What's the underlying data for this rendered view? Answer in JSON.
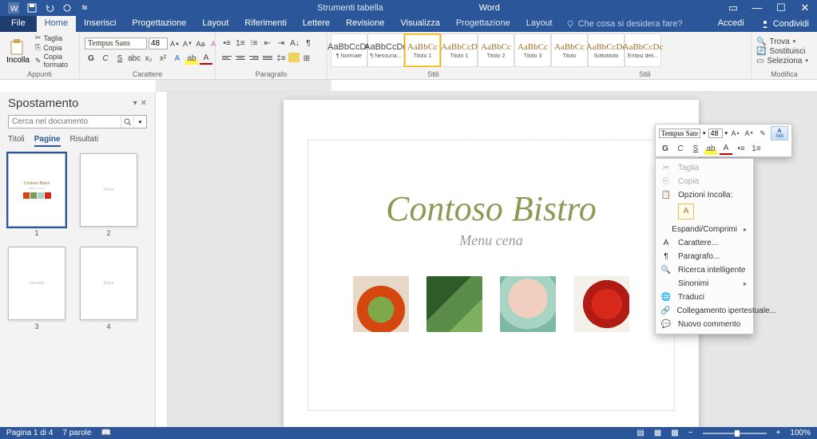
{
  "titlebar": {
    "contextual_tab_title": "Strumenti tabella",
    "app_name": "Word"
  },
  "tabs": {
    "file": "File",
    "home": "Home",
    "insert": "Inserisci",
    "design": "Progettazione",
    "layout": "Layout",
    "references": "Riferimenti",
    "mailings": "Lettere",
    "review": "Revisione",
    "view": "Visualizza",
    "table_design": "Progettazione",
    "table_layout": "Layout",
    "tell_me": "Che cosa si desidera fare?",
    "sign_in": "Accedi",
    "share": "Condividi"
  },
  "ribbon": {
    "clipboard": {
      "paste": "Incolla",
      "cut": "Taglia",
      "copy": "Copia",
      "format_painter": "Copia formato",
      "label": "Appunti"
    },
    "font": {
      "name": "Tempus Sans",
      "size": "48",
      "bold": "G",
      "italic": "C",
      "underline": "S",
      "label": "Carattere"
    },
    "paragraph": {
      "label": "Paragrafo"
    },
    "styles": {
      "label": "Stili",
      "items": [
        {
          "preview": "AaBbCcDc",
          "name": "¶ Normale",
          "normal": true
        },
        {
          "preview": "AaBbCcDc",
          "name": "¶ Nessuna...",
          "normal": true
        },
        {
          "preview": "AaBbCc",
          "name": "Titolo 1"
        },
        {
          "preview": "AaBbCcD",
          "name": "Titolo 1"
        },
        {
          "preview": "AaBbCc",
          "name": "Titolo 2"
        },
        {
          "preview": "AaBbCc",
          "name": "Titolo 3"
        },
        {
          "preview": "AaBbCc",
          "name": "Titolo"
        },
        {
          "preview": "AaBbCcDc",
          "name": "Sottotitolo"
        },
        {
          "preview": "AaBbCcDc",
          "name": "Enfasi deli..."
        }
      ]
    },
    "editing": {
      "find": "Trova",
      "replace": "Sostituisci",
      "select": "Seleziona",
      "label": "Modifica"
    }
  },
  "navpane": {
    "title": "Spostamento",
    "search_placeholder": "Cerca nel documento",
    "tabs": {
      "headings": "Titoli",
      "pages": "Pagine",
      "results": "Risultati"
    },
    "thumbs": [
      "1",
      "2",
      "3",
      "4"
    ],
    "thumb1_title": "Contoso Bistro",
    "thumb1_sub": "Menu cena"
  },
  "document": {
    "title": "Contoso Bistro",
    "subtitle": "Menu cena"
  },
  "mini_toolbar": {
    "font_name": "Tempus Sans",
    "font_size": "48",
    "bold": "G",
    "italic": "C",
    "underline": "S",
    "styles_label": "Stili"
  },
  "context_menu": {
    "cut": "Taglia",
    "copy": "Copia",
    "paste_options": "Opzioni Incolla:",
    "expand_collapse": "Espandi/Comprimi",
    "font": "Carattere...",
    "paragraph": "Paragrafo...",
    "smart_lookup": "Ricerca intelligente",
    "synonyms": "Sinonimi",
    "translate": "Traduci",
    "hyperlink": "Collegamento ipertestuale...",
    "new_comment": "Nuovo commento"
  },
  "statusbar": {
    "page": "Pagina 1 di 4",
    "words": "7 parole",
    "zoom": "100%"
  }
}
